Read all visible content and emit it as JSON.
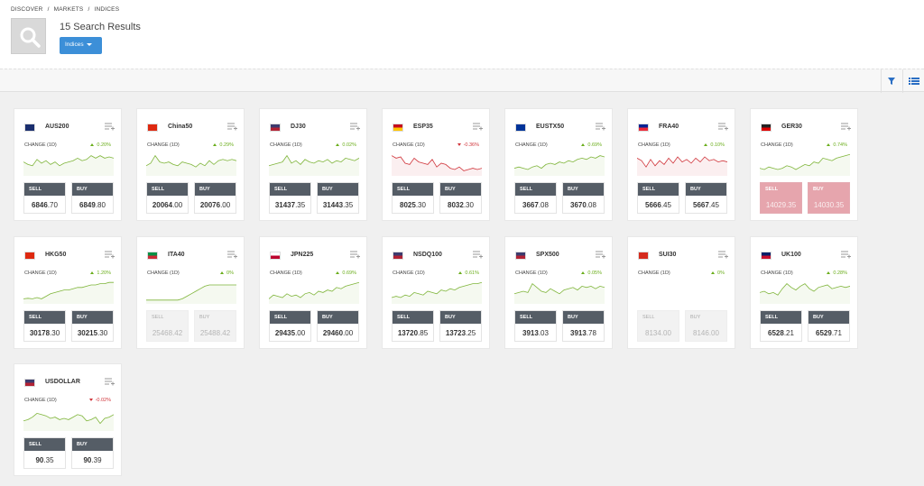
{
  "breadcrumb": [
    "DISCOVER",
    "/",
    "MARKETS",
    "/",
    "INDICES"
  ],
  "header": {
    "results_title": "15 Search Results",
    "filter_button": "Indices"
  },
  "toolbar": {
    "filter_icon": "filter-icon",
    "list_icon": "list-view-icon"
  },
  "colors": {
    "up": "#6aad1a",
    "down": "#d0343a",
    "accent": "#3c8fd8",
    "trade_label_bg": "#555d66",
    "closed": "#e6a5ad"
  },
  "change_label": "CHANGE (1D)",
  "sell_label": "SELL",
  "buy_label": "BUY",
  "instruments": [
    {
      "name": "AUS200",
      "change": "0.20%",
      "direction": "up",
      "sell_int": "6846",
      "sell_dec": ".70",
      "buy_int": "6849",
      "buy_dec": ".80",
      "state": "open",
      "flag": [
        "#1a2e6e",
        "#1a2e6e"
      ],
      "spark": [
        0.45,
        0.55,
        0.6,
        0.35,
        0.5,
        0.4,
        0.55,
        0.45,
        0.6,
        0.5,
        0.45,
        0.4,
        0.3,
        0.4,
        0.35,
        0.2,
        0.3,
        0.2,
        0.3,
        0.25,
        0.3
      ]
    },
    {
      "name": "China50",
      "change": "0.29%",
      "direction": "up",
      "sell_int": "20064",
      "sell_dec": ".00",
      "buy_int": "20076",
      "buy_dec": ".00",
      "state": "open",
      "flag": [
        "#de2910",
        "#de2910"
      ],
      "spark": [
        0.6,
        0.5,
        0.2,
        0.45,
        0.5,
        0.45,
        0.55,
        0.6,
        0.45,
        0.5,
        0.55,
        0.65,
        0.5,
        0.6,
        0.4,
        0.55,
        0.4,
        0.35,
        0.4,
        0.35,
        0.4
      ]
    },
    {
      "name": "DJ30",
      "change": "0.02%",
      "direction": "up",
      "sell_int": "31437",
      "sell_dec": ".35",
      "buy_int": "31443",
      "buy_dec": ".35",
      "state": "open",
      "flag": [
        "#3c3b6e",
        "#b22234"
      ],
      "spark": [
        0.6,
        0.55,
        0.5,
        0.45,
        0.2,
        0.5,
        0.4,
        0.55,
        0.35,
        0.45,
        0.5,
        0.4,
        0.45,
        0.35,
        0.5,
        0.4,
        0.45,
        0.3,
        0.35,
        0.4,
        0.3
      ]
    },
    {
      "name": "ESP35",
      "change": "-0.36%",
      "direction": "down",
      "sell_int": "8025",
      "sell_dec": ".30",
      "buy_int": "8032",
      "buy_dec": ".30",
      "state": "open",
      "flag": [
        "#c60b1e",
        "#ffc400"
      ],
      "spark": [
        0.2,
        0.3,
        0.25,
        0.5,
        0.55,
        0.3,
        0.45,
        0.5,
        0.55,
        0.35,
        0.65,
        0.5,
        0.55,
        0.7,
        0.75,
        0.65,
        0.8,
        0.75,
        0.7,
        0.75,
        0.7
      ]
    },
    {
      "name": "EUSTX50",
      "change": "0.69%",
      "direction": "up",
      "sell_int": "3667",
      "sell_dec": ".08",
      "buy_int": "3670",
      "buy_dec": ".08",
      "state": "open",
      "flag": [
        "#003399",
        "#003399"
      ],
      "spark": [
        0.7,
        0.65,
        0.7,
        0.75,
        0.65,
        0.6,
        0.7,
        0.55,
        0.5,
        0.55,
        0.45,
        0.5,
        0.4,
        0.45,
        0.35,
        0.3,
        0.35,
        0.25,
        0.3,
        0.2,
        0.25
      ]
    },
    {
      "name": "FRA40",
      "change": "0.10%",
      "direction": "up",
      "sell_int": "5666",
      "sell_dec": ".45",
      "buy_int": "5667",
      "buy_dec": ".45",
      "state": "open",
      "flag": [
        "#002395",
        "#ed2939"
      ],
      "spark": [
        0.3,
        0.4,
        0.65,
        0.35,
        0.6,
        0.4,
        0.55,
        0.3,
        0.5,
        0.25,
        0.45,
        0.35,
        0.5,
        0.3,
        0.45,
        0.25,
        0.4,
        0.35,
        0.45,
        0.4,
        0.45
      ],
      "red": true
    },
    {
      "name": "GER30",
      "change": "0.74%",
      "direction": "up",
      "sell_int": "14029",
      "sell_dec": ".35",
      "buy_int": "14030",
      "buy_dec": ".35",
      "state": "closed",
      "flag": [
        "#222",
        "#dd0000"
      ],
      "spark": [
        0.7,
        0.75,
        0.65,
        0.7,
        0.75,
        0.7,
        0.6,
        0.65,
        0.75,
        0.65,
        0.55,
        0.6,
        0.45,
        0.5,
        0.3,
        0.35,
        0.4,
        0.3,
        0.25,
        0.2,
        0.15
      ]
    },
    {
      "name": "HKG50",
      "change": "1.20%",
      "direction": "up",
      "sell_int": "30178",
      "sell_dec": ".30",
      "buy_int": "30215",
      "buy_dec": ".30",
      "state": "open",
      "flag": [
        "#de2910",
        "#de2910"
      ],
      "spark": [
        0.8,
        0.78,
        0.8,
        0.75,
        0.8,
        0.7,
        0.6,
        0.55,
        0.5,
        0.45,
        0.45,
        0.4,
        0.35,
        0.35,
        0.3,
        0.25,
        0.25,
        0.2,
        0.2,
        0.15,
        0.15
      ]
    },
    {
      "name": "ITA40",
      "change": "0%",
      "direction": "up",
      "sell_int": "25468",
      "sell_dec": ".42",
      "buy_int": "25488",
      "buy_dec": ".42",
      "state": "disabled",
      "flag": [
        "#009246",
        "#ce2b37"
      ],
      "spark": [
        0.85,
        0.85,
        0.85,
        0.85,
        0.85,
        0.85,
        0.85,
        0.85,
        0.8,
        0.7,
        0.6,
        0.5,
        0.4,
        0.3,
        0.25,
        0.25,
        0.25,
        0.25,
        0.25,
        0.25,
        0.25
      ]
    },
    {
      "name": "JPN225",
      "change": "0.69%",
      "direction": "up",
      "sell_int": "29435",
      "sell_dec": ".00",
      "buy_int": "29460",
      "buy_dec": ".00",
      "state": "open",
      "flag": [
        "#fff",
        "#bc002d"
      ],
      "spark": [
        0.8,
        0.65,
        0.7,
        0.75,
        0.6,
        0.7,
        0.65,
        0.75,
        0.6,
        0.55,
        0.65,
        0.5,
        0.55,
        0.45,
        0.5,
        0.35,
        0.4,
        0.3,
        0.25,
        0.2,
        0.15
      ]
    },
    {
      "name": "NSDQ100",
      "change": "0.61%",
      "direction": "up",
      "sell_int": "13720",
      "sell_dec": ".85",
      "buy_int": "13723",
      "buy_dec": ".25",
      "state": "open",
      "flag": [
        "#3c3b6e",
        "#b22234"
      ],
      "spark": [
        0.75,
        0.7,
        0.75,
        0.65,
        0.7,
        0.55,
        0.6,
        0.65,
        0.5,
        0.55,
        0.6,
        0.45,
        0.5,
        0.4,
        0.45,
        0.35,
        0.3,
        0.25,
        0.2,
        0.2,
        0.15
      ]
    },
    {
      "name": "SPX500",
      "change": "0.05%",
      "direction": "up",
      "sell_int": "3913",
      "sell_dec": ".03",
      "buy_int": "3913",
      "buy_dec": ".78",
      "state": "open",
      "flag": [
        "#3c3b6e",
        "#b22234"
      ],
      "spark": [
        0.6,
        0.55,
        0.5,
        0.55,
        0.2,
        0.35,
        0.5,
        0.55,
        0.4,
        0.5,
        0.6,
        0.45,
        0.4,
        0.35,
        0.45,
        0.3,
        0.35,
        0.3,
        0.4,
        0.3,
        0.35
      ]
    },
    {
      "name": "SUI30",
      "change": "0%",
      "direction": "up",
      "sell_int": "8134",
      "sell_dec": ".00",
      "buy_int": "8146",
      "buy_dec": ".00",
      "state": "disabled",
      "flag": [
        "#d52b1e",
        "#d52b1e"
      ],
      "spark": []
    },
    {
      "name": "UK100",
      "change": "0.28%",
      "direction": "up",
      "sell_int": "6528",
      "sell_dec": ".21",
      "buy_int": "6529",
      "buy_dec": ".71",
      "state": "open",
      "flag": [
        "#012169",
        "#c8102e"
      ],
      "spark": [
        0.55,
        0.5,
        0.6,
        0.55,
        0.65,
        0.4,
        0.2,
        0.35,
        0.45,
        0.3,
        0.2,
        0.4,
        0.5,
        0.35,
        0.3,
        0.25,
        0.4,
        0.35,
        0.3,
        0.35,
        0.3
      ]
    },
    {
      "name": "USDOLLAR",
      "change": "-0.02%",
      "direction": "down",
      "sell_int": "90",
      "sell_dec": ".35",
      "buy_int": "90",
      "buy_dec": ".39",
      "state": "open",
      "flag": [
        "#3c3b6e",
        "#b22234"
      ],
      "spark": [
        0.6,
        0.55,
        0.45,
        0.3,
        0.35,
        0.4,
        0.5,
        0.45,
        0.55,
        0.5,
        0.55,
        0.45,
        0.35,
        0.4,
        0.6,
        0.55,
        0.45,
        0.7,
        0.5,
        0.45,
        0.35
      ]
    }
  ]
}
